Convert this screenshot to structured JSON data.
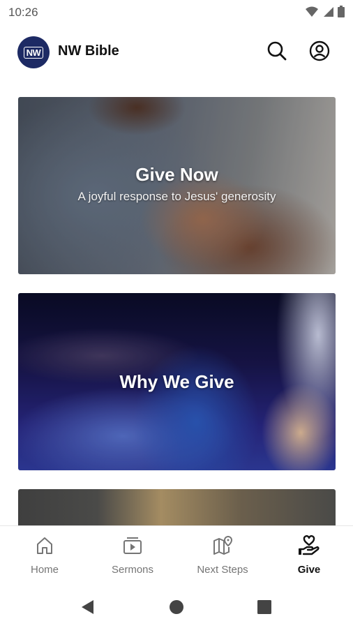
{
  "status_bar": {
    "time": "10:26"
  },
  "header": {
    "logo_text": "NW",
    "title": "NW Bible"
  },
  "cards": [
    {
      "title": "Give Now",
      "subtitle": "A joyful response to Jesus' generosity"
    },
    {
      "title": "Why We Give",
      "subtitle": ""
    },
    {
      "title": "",
      "subtitle": ""
    }
  ],
  "bottom_nav": {
    "items": [
      {
        "label": "Home",
        "icon": "home-icon"
      },
      {
        "label": "Sermons",
        "icon": "video-icon"
      },
      {
        "label": "Next Steps",
        "icon": "map-pin-icon"
      },
      {
        "label": "Give",
        "icon": "giving-hand-heart-icon"
      }
    ],
    "active_index": 3
  },
  "colors": {
    "brand": "#1d2a64",
    "active": "#111111",
    "inactive": "#757575"
  }
}
